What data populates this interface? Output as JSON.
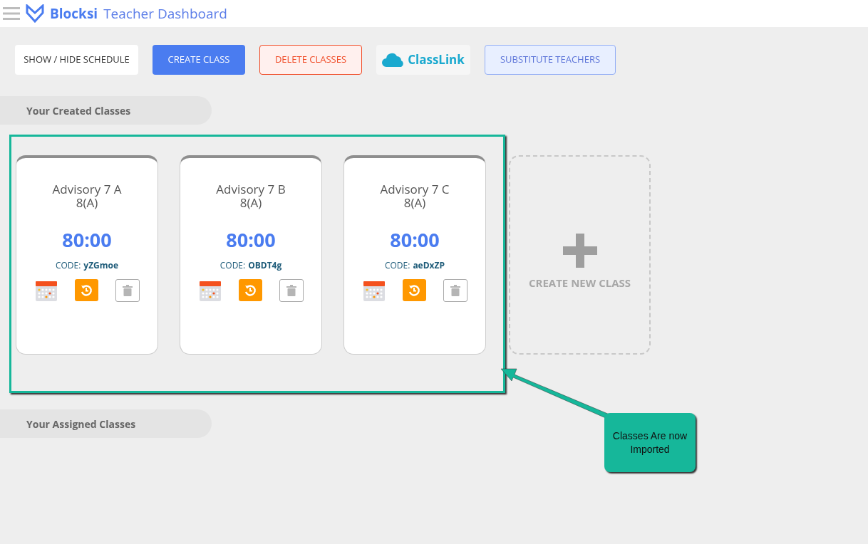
{
  "header": {
    "brand": "Blocksi",
    "title": "Teacher Dashboard"
  },
  "toolbar": [
    {
      "kind": "plain",
      "label": "SHOW / HIDE SCHEDULE"
    },
    {
      "kind": "primary",
      "label": "CREATE CLASS"
    },
    {
      "kind": "danger",
      "label": "DELETE CLASSES"
    },
    {
      "kind": "logo",
      "label": "ClassLink"
    },
    {
      "kind": "soft",
      "label": "SUBSTITUTE TEACHERS"
    }
  ],
  "created_section": {
    "title": "Your Created Classes"
  },
  "classes": [
    {
      "name": "Advisory 7 A",
      "section": "8(A)",
      "timer": "80:00",
      "code_label": "CODE:",
      "code": "yZGmoe"
    },
    {
      "name": "Advisory 7 B",
      "section": "8(A)",
      "timer": "80:00",
      "code_label": "CODE:",
      "code": "OBDT4g"
    },
    {
      "name": "Advisory 7 C",
      "section": "8(A)",
      "timer": "80:00",
      "code_label": "CODE:",
      "code": "aeDxZP"
    }
  ],
  "new_class": {
    "label": "CREATE NEW CLASS"
  },
  "assigned_section": {
    "title": "Your Assigned Classes"
  },
  "callout": {
    "text": "Classes Are now Imported"
  }
}
